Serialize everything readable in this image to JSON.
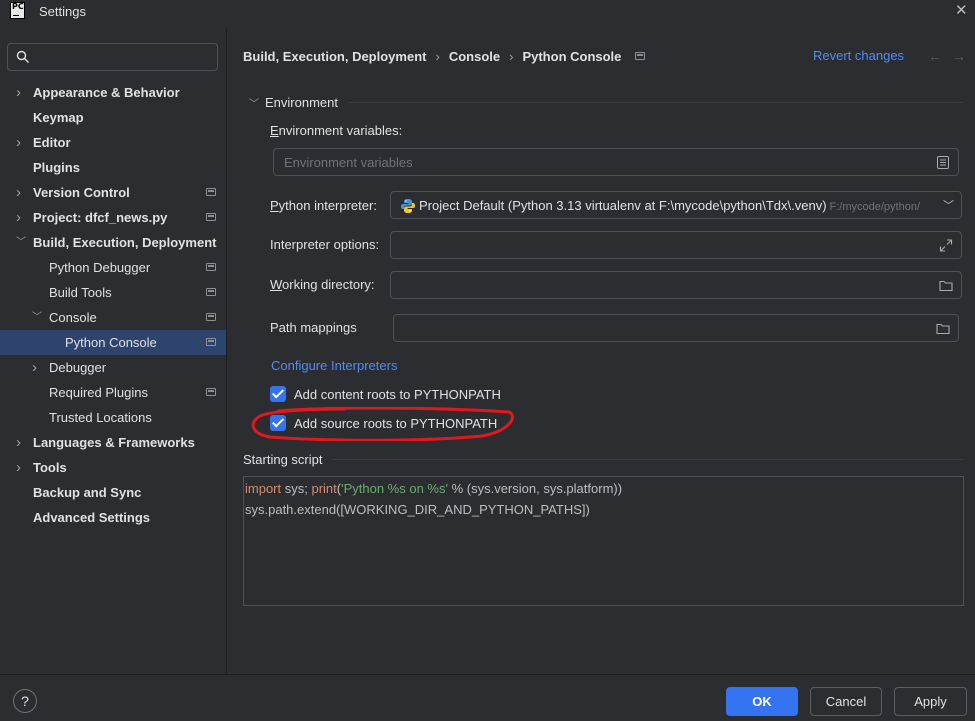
{
  "window": {
    "title": "Settings",
    "logo_text": "PC"
  },
  "search": {
    "value": "",
    "placeholder": ""
  },
  "tree": [
    {
      "label": "Appearance & Behavior",
      "bold": true,
      "level": 0,
      "chevron": "right",
      "proj": false,
      "selected": false
    },
    {
      "label": "Keymap",
      "bold": true,
      "level": 0,
      "chevron": "",
      "proj": false,
      "selected": false
    },
    {
      "label": "Editor",
      "bold": true,
      "level": 0,
      "chevron": "right",
      "proj": false,
      "selected": false
    },
    {
      "label": "Plugins",
      "bold": true,
      "level": 0,
      "chevron": "",
      "proj": false,
      "selected": false
    },
    {
      "label": "Version Control",
      "bold": true,
      "level": 0,
      "chevron": "right",
      "proj": true,
      "selected": false
    },
    {
      "label": "Project: dfcf_news.py",
      "bold": true,
      "level": 0,
      "chevron": "right",
      "proj": true,
      "selected": false
    },
    {
      "label": "Build, Execution, Deployment",
      "bold": true,
      "level": 0,
      "chevron": "down",
      "proj": false,
      "selected": false
    },
    {
      "label": "Python Debugger",
      "bold": false,
      "level": 1,
      "chevron": "",
      "proj": true,
      "selected": false
    },
    {
      "label": "Build Tools",
      "bold": false,
      "level": 1,
      "chevron": "",
      "proj": true,
      "selected": false
    },
    {
      "label": "Console",
      "bold": false,
      "level": 1,
      "chevron": "down",
      "proj": true,
      "selected": false
    },
    {
      "label": "Python Console",
      "bold": false,
      "level": 2,
      "chevron": "",
      "proj": true,
      "selected": true
    },
    {
      "label": "Debugger",
      "bold": false,
      "level": 1,
      "chevron": "right",
      "proj": false,
      "selected": false
    },
    {
      "label": "Required Plugins",
      "bold": false,
      "level": 1,
      "chevron": "",
      "proj": true,
      "selected": false
    },
    {
      "label": "Trusted Locations",
      "bold": false,
      "level": 1,
      "chevron": "",
      "proj": false,
      "selected": false
    },
    {
      "label": "Languages & Frameworks",
      "bold": true,
      "level": 0,
      "chevron": "right",
      "proj": false,
      "selected": false
    },
    {
      "label": "Tools",
      "bold": true,
      "level": 0,
      "chevron": "right",
      "proj": false,
      "selected": false
    },
    {
      "label": "Backup and Sync",
      "bold": true,
      "level": 0,
      "chevron": "",
      "proj": false,
      "selected": false
    },
    {
      "label": "Advanced Settings",
      "bold": true,
      "level": 0,
      "chevron": "",
      "proj": false,
      "selected": false
    }
  ],
  "breadcrumb": {
    "items": [
      "Build, Execution, Deployment",
      "Console",
      "Python Console"
    ],
    "separator": "›"
  },
  "header": {
    "revert_label": "Revert changes",
    "back_arrow": "←",
    "forward_arrow": "→"
  },
  "environment": {
    "section_title": "Environment",
    "env_vars_label_underline": "E",
    "env_vars_label_rest": "nvironment variables:",
    "env_vars_placeholder": "Environment variables",
    "interpreter_label_underline": "P",
    "interpreter_label_rest": "ython interpreter:",
    "interpreter_value": "Project Default (Python 3.13 virtualenv at F:\\mycode\\python\\Tdx\\.venv)",
    "interpreter_hint": "F:/mycode/python/",
    "interpreter_options_label": "Interpreter options:",
    "interpreter_options_value": "",
    "working_dir_label_underline": "W",
    "working_dir_label_rest": "orking directory:",
    "working_dir_value": "",
    "path_mappings_label": "Path mappings",
    "path_mappings_value": "",
    "configure_link": "Configure Interpreters",
    "checkbox_content_roots": "Add content roots to PYTHONPATH",
    "checkbox_content_roots_checked": true,
    "checkbox_source_roots": "Add source roots to PYTHONPATH",
    "checkbox_source_roots_checked": true
  },
  "starting_script": {
    "title": "Starting script",
    "line1": {
      "kw": "import",
      "a": " sys; ",
      "fn": "print",
      "b": "(",
      "str": "'Python %s on %s'",
      "c": " % (sys.version, sys.platform))"
    },
    "line2": "sys.path.extend([WORKING_DIR_AND_PYTHON_PATHS])"
  },
  "footer": {
    "help_label": "?",
    "ok_label": "OK",
    "cancel_label": "Cancel",
    "apply_label": "Apply"
  },
  "colors": {
    "accent": "#3574f0",
    "link": "#548af7",
    "annotation": "#e0191e",
    "selected_row": "#2e436e"
  },
  "icons": {
    "search": "search-icon",
    "env_vars_edit": "list-edit-icon",
    "expand": "expand-icon",
    "folder": "folder-icon",
    "python": "python-icon",
    "project_scope": "project-scope-icon"
  }
}
